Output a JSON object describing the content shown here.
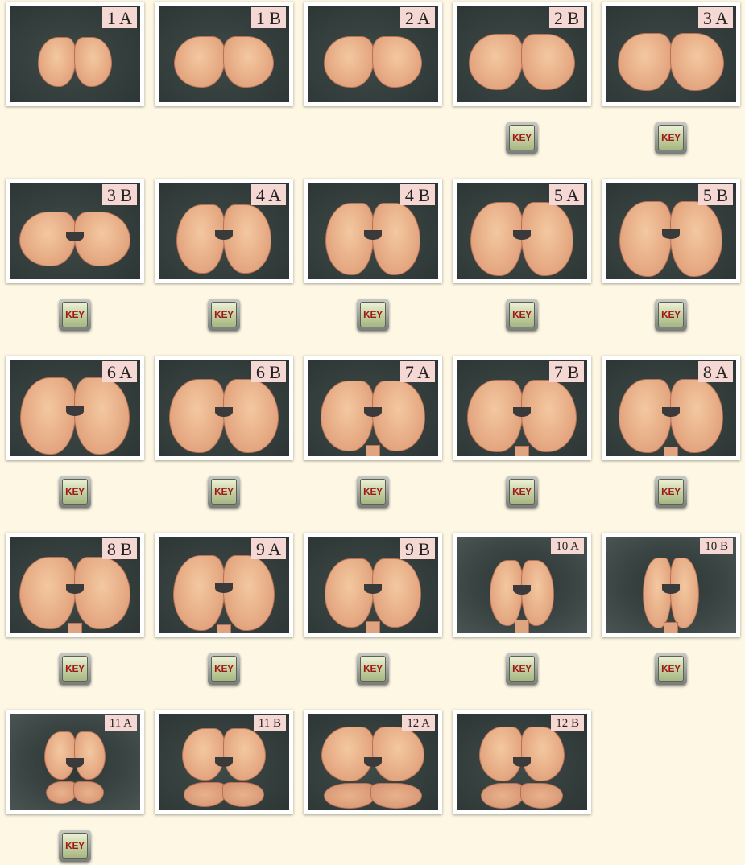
{
  "colors": {
    "page_background": "#fdf7e3",
    "photo_background": "#3a4543",
    "label_background": "#f5d7d3",
    "key_text": "#a01818"
  },
  "key_label": "KEY",
  "slices": [
    {
      "label": "1 A",
      "has_key": false
    },
    {
      "label": "1 B",
      "has_key": false
    },
    {
      "label": "2 A",
      "has_key": false
    },
    {
      "label": "2 B",
      "has_key": true
    },
    {
      "label": "3 A",
      "has_key": true
    },
    {
      "label": "3 B",
      "has_key": true
    },
    {
      "label": "4 A",
      "has_key": true
    },
    {
      "label": "4 B",
      "has_key": true
    },
    {
      "label": "5 A",
      "has_key": true
    },
    {
      "label": "5 B",
      "has_key": true
    },
    {
      "label": "6 A",
      "has_key": true
    },
    {
      "label": "6 B",
      "has_key": true
    },
    {
      "label": "7 A",
      "has_key": true
    },
    {
      "label": "7 B",
      "has_key": true
    },
    {
      "label": "8 A",
      "has_key": true
    },
    {
      "label": "8 B",
      "has_key": true
    },
    {
      "label": "9 A",
      "has_key": true
    },
    {
      "label": "9 B",
      "has_key": true
    },
    {
      "label": "10 A",
      "has_key": true
    },
    {
      "label": "10 B",
      "has_key": true
    },
    {
      "label": "11 A",
      "has_key": true
    },
    {
      "label": "11 B",
      "has_key": false
    },
    {
      "label": "12 A",
      "has_key": false
    },
    {
      "label": "12 B",
      "has_key": false
    }
  ]
}
